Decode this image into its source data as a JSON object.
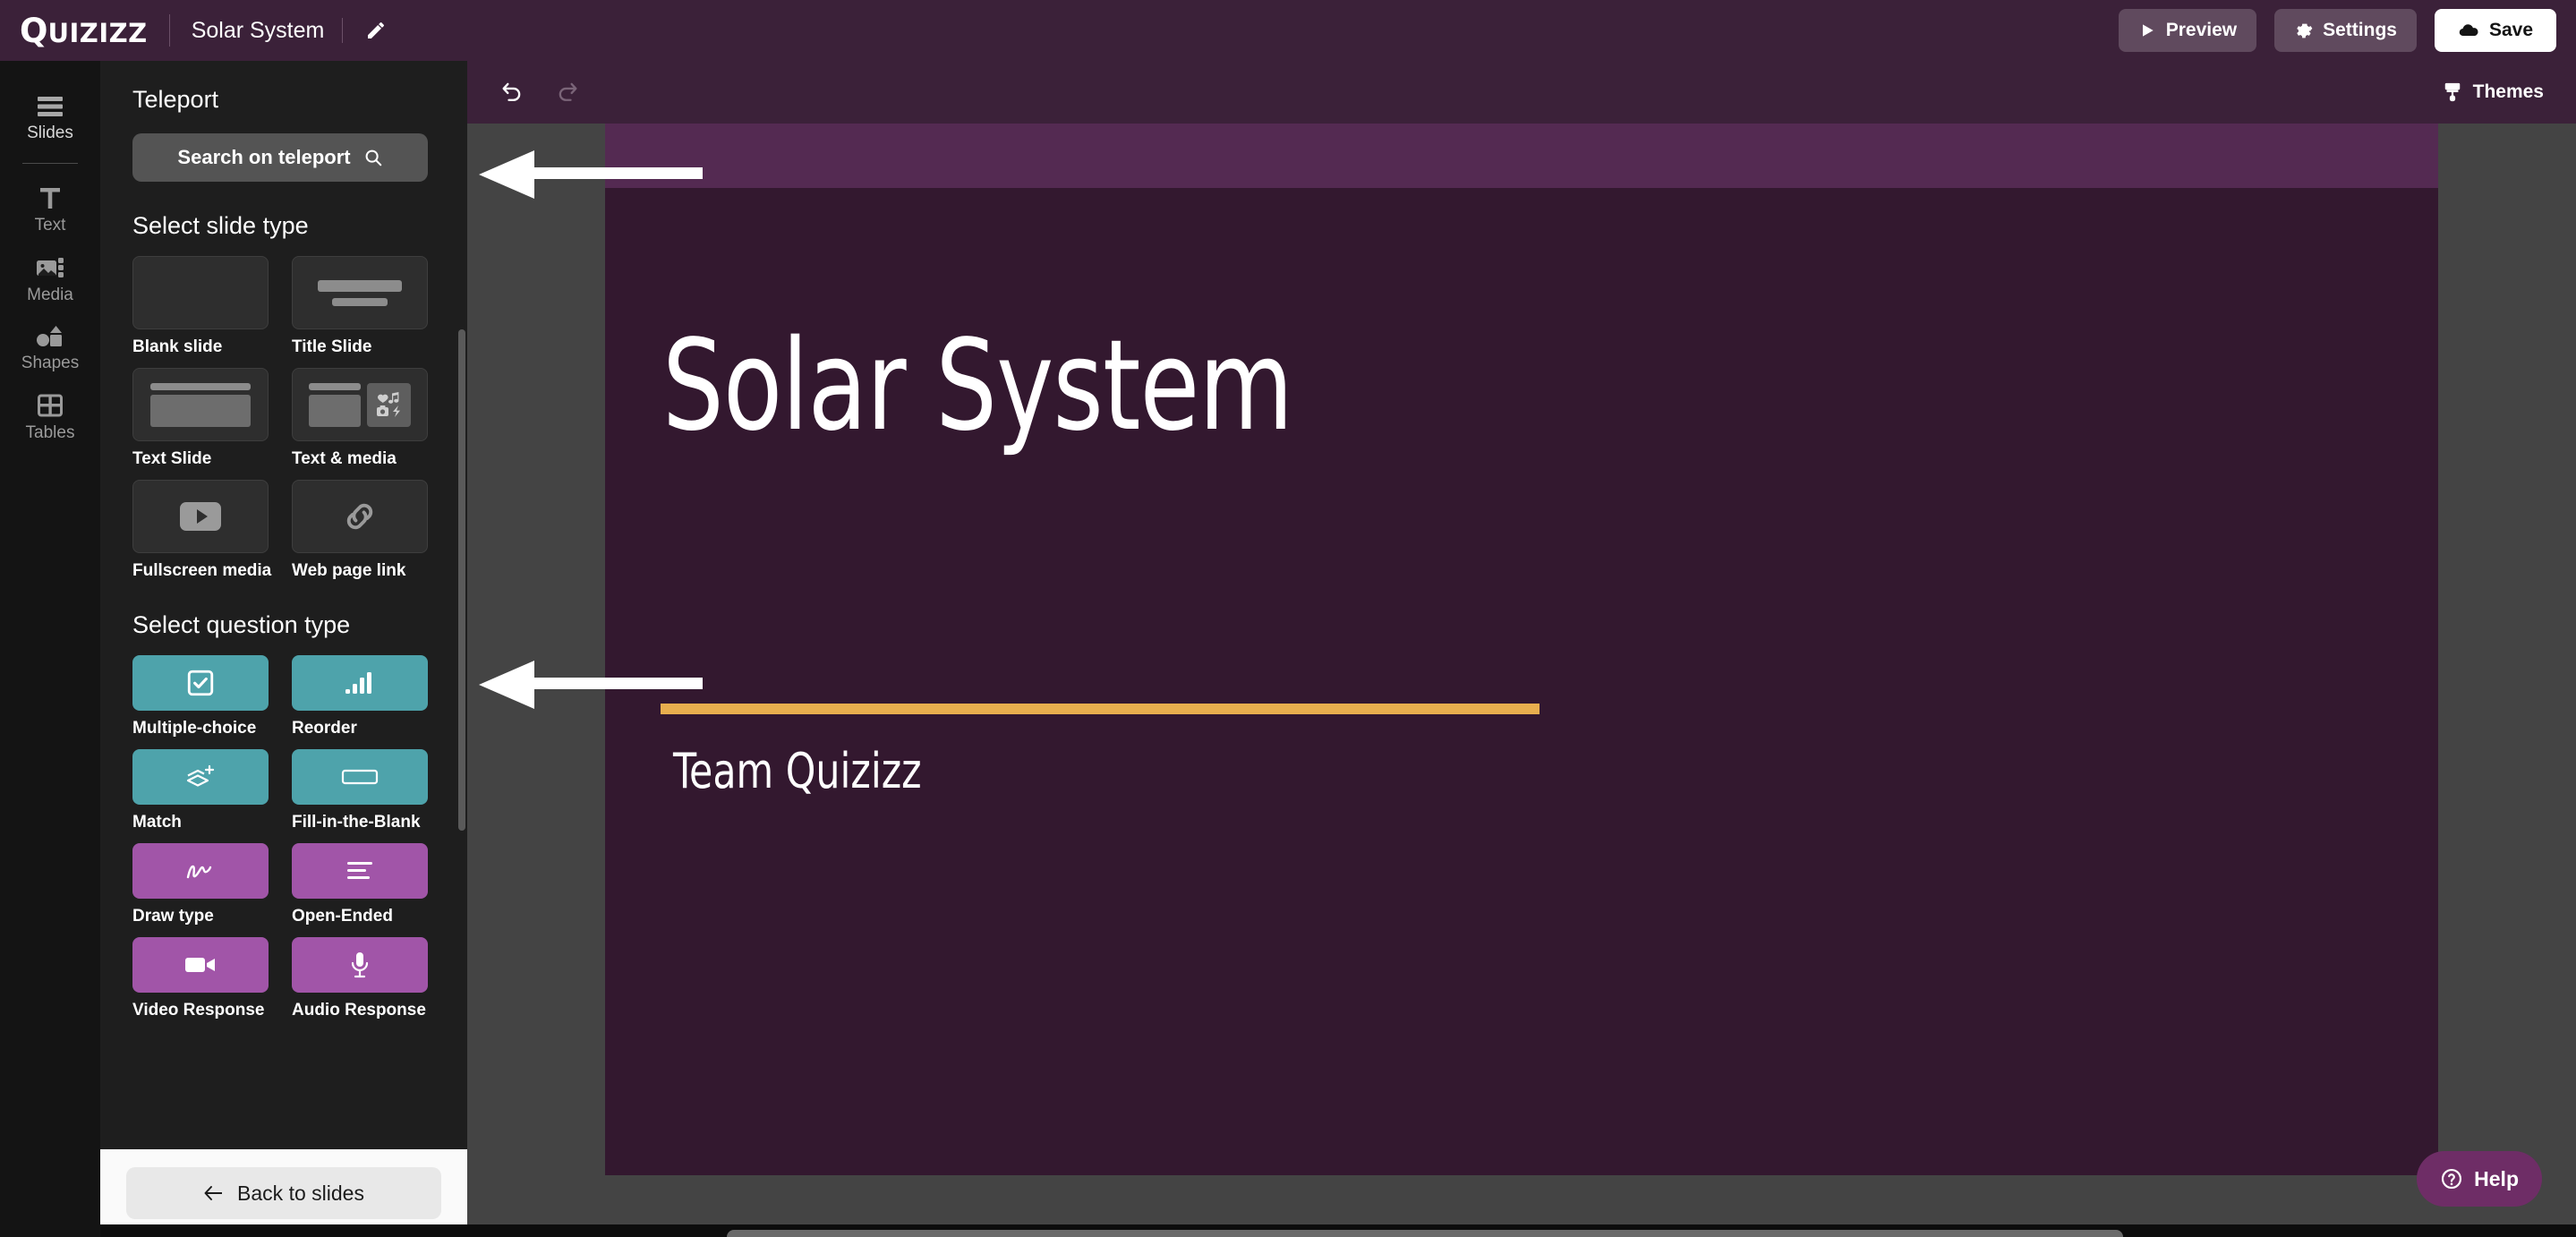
{
  "app": {
    "brand_q": "Q",
    "brand_rest": "UIZIZZ",
    "document_title": "Solar System"
  },
  "topbar": {
    "edit_title_icon": "pencil-icon",
    "preview_label": "Preview",
    "settings_label": "Settings",
    "save_label": "Save"
  },
  "rail": {
    "items": [
      {
        "label": "Slides",
        "icon": "slides-icon"
      },
      {
        "label": "Text",
        "icon": "text-icon"
      },
      {
        "label": "Media",
        "icon": "media-icon"
      },
      {
        "label": "Shapes",
        "icon": "shapes-icon"
      },
      {
        "label": "Tables",
        "icon": "tables-icon"
      }
    ]
  },
  "panel": {
    "teleport_heading": "Teleport",
    "search_label": "Search on teleport",
    "search_icon": "search-icon",
    "slide_type_heading": "Select slide type",
    "slide_types": [
      {
        "label": "Blank slide",
        "icon": "blank-slide-icon"
      },
      {
        "label": "Title Slide",
        "icon": "title-slide-icon"
      },
      {
        "label": "Text Slide",
        "icon": "text-slide-icon"
      },
      {
        "label": "Text & media",
        "icon": "text-media-icon"
      },
      {
        "label": "Fullscreen media",
        "icon": "play-icon"
      },
      {
        "label": "Web page link",
        "icon": "link-icon"
      }
    ],
    "question_type_heading": "Select question type",
    "question_types": [
      {
        "label": "Multiple-choice",
        "icon": "checkbox-icon",
        "color": "#4ea3ab"
      },
      {
        "label": "Reorder",
        "icon": "bars-icon",
        "color": "#4ea3ab"
      },
      {
        "label": "Match",
        "icon": "layers-plus-icon",
        "color": "#4ea3ab"
      },
      {
        "label": "Fill-in-the-Blank",
        "icon": "blank-box-icon",
        "color": "#4ea3ab"
      },
      {
        "label": "Draw type",
        "icon": "squiggle-icon",
        "color": "#a155a8"
      },
      {
        "label": "Open-Ended",
        "icon": "lines-icon",
        "color": "#a155a8"
      },
      {
        "label": "Video Response",
        "icon": "video-camera-icon",
        "color": "#a155a8"
      },
      {
        "label": "Audio Response",
        "icon": "microphone-icon",
        "color": "#a155a8"
      }
    ],
    "back_label": "Back to slides",
    "back_icon": "arrow-left-icon"
  },
  "canvas_toolbar": {
    "undo_icon": "undo-icon",
    "redo_icon": "redo-icon",
    "themes_label": "Themes",
    "themes_icon": "paint-roller-icon"
  },
  "slide": {
    "title": "Solar System",
    "subtitle": "Team Quizizz",
    "band_color": "#542a52",
    "background_color": "#33182f",
    "rule_color": "#e8ae4e",
    "text_color": "#ffffff"
  },
  "help": {
    "label": "Help",
    "icon": "question-circle-icon"
  },
  "annotations": {
    "arrows": [
      {
        "name": "arrow-to-search-on-teleport",
        "direction": "left"
      },
      {
        "name": "arrow-to-select-question-type",
        "direction": "left"
      }
    ]
  },
  "colors": {
    "brand_purple": "#3b2139",
    "teal": "#4ea3ab",
    "purple": "#a155a8",
    "gold": "#e8ae4e"
  }
}
